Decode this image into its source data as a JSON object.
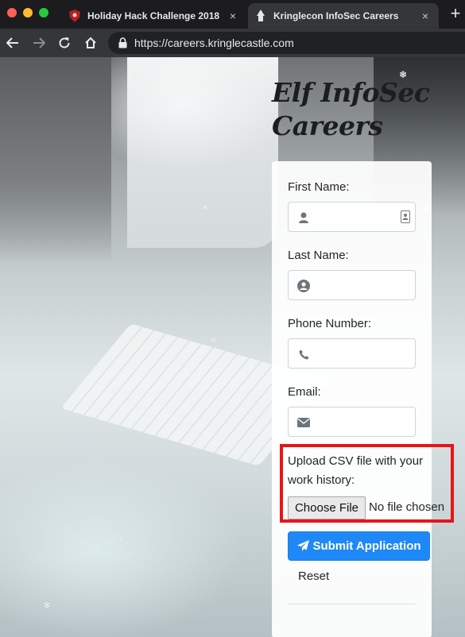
{
  "browser": {
    "tabs": [
      {
        "title": "Holiday Hack Challenge 2018",
        "active": false
      },
      {
        "title": "Kringlecon InfoSec Careers",
        "active": true
      }
    ],
    "new_tab_symbol": "+",
    "close_symbol": "×",
    "url": "https://careers.kringlecastle.com"
  },
  "page": {
    "title_line1": "Elf InfoSec",
    "title_line2": "Careers",
    "form": {
      "first_name_label": "First Name:",
      "last_name_label": "Last Name:",
      "phone_label": "Phone Number:",
      "email_label": "Email:",
      "upload_label": "Upload CSV file with your work history:",
      "choose_file_label": "Choose File",
      "no_file_text": "No file chosen",
      "submit_label": "Submit Application",
      "reset_label": "Reset",
      "first_name_value": "",
      "last_name_value": "",
      "phone_value": "",
      "email_value": ""
    },
    "snowflake_glyph": "❄",
    "highlight_color": "#e8141a"
  },
  "colors": {
    "submit_button": "#1f88f7",
    "tab_strip": "#1c1c1e",
    "toolbar": "#35363a"
  },
  "icons": [
    "shield-favicon-icon",
    "kringlecon-favicon-icon",
    "back-arrow-icon",
    "forward-arrow-icon",
    "reload-icon",
    "home-icon",
    "lock-icon",
    "user-icon",
    "contact-card-icon",
    "user-circle-icon",
    "phone-icon",
    "envelope-icon",
    "paper-plane-icon",
    "snowflake-icon"
  ]
}
